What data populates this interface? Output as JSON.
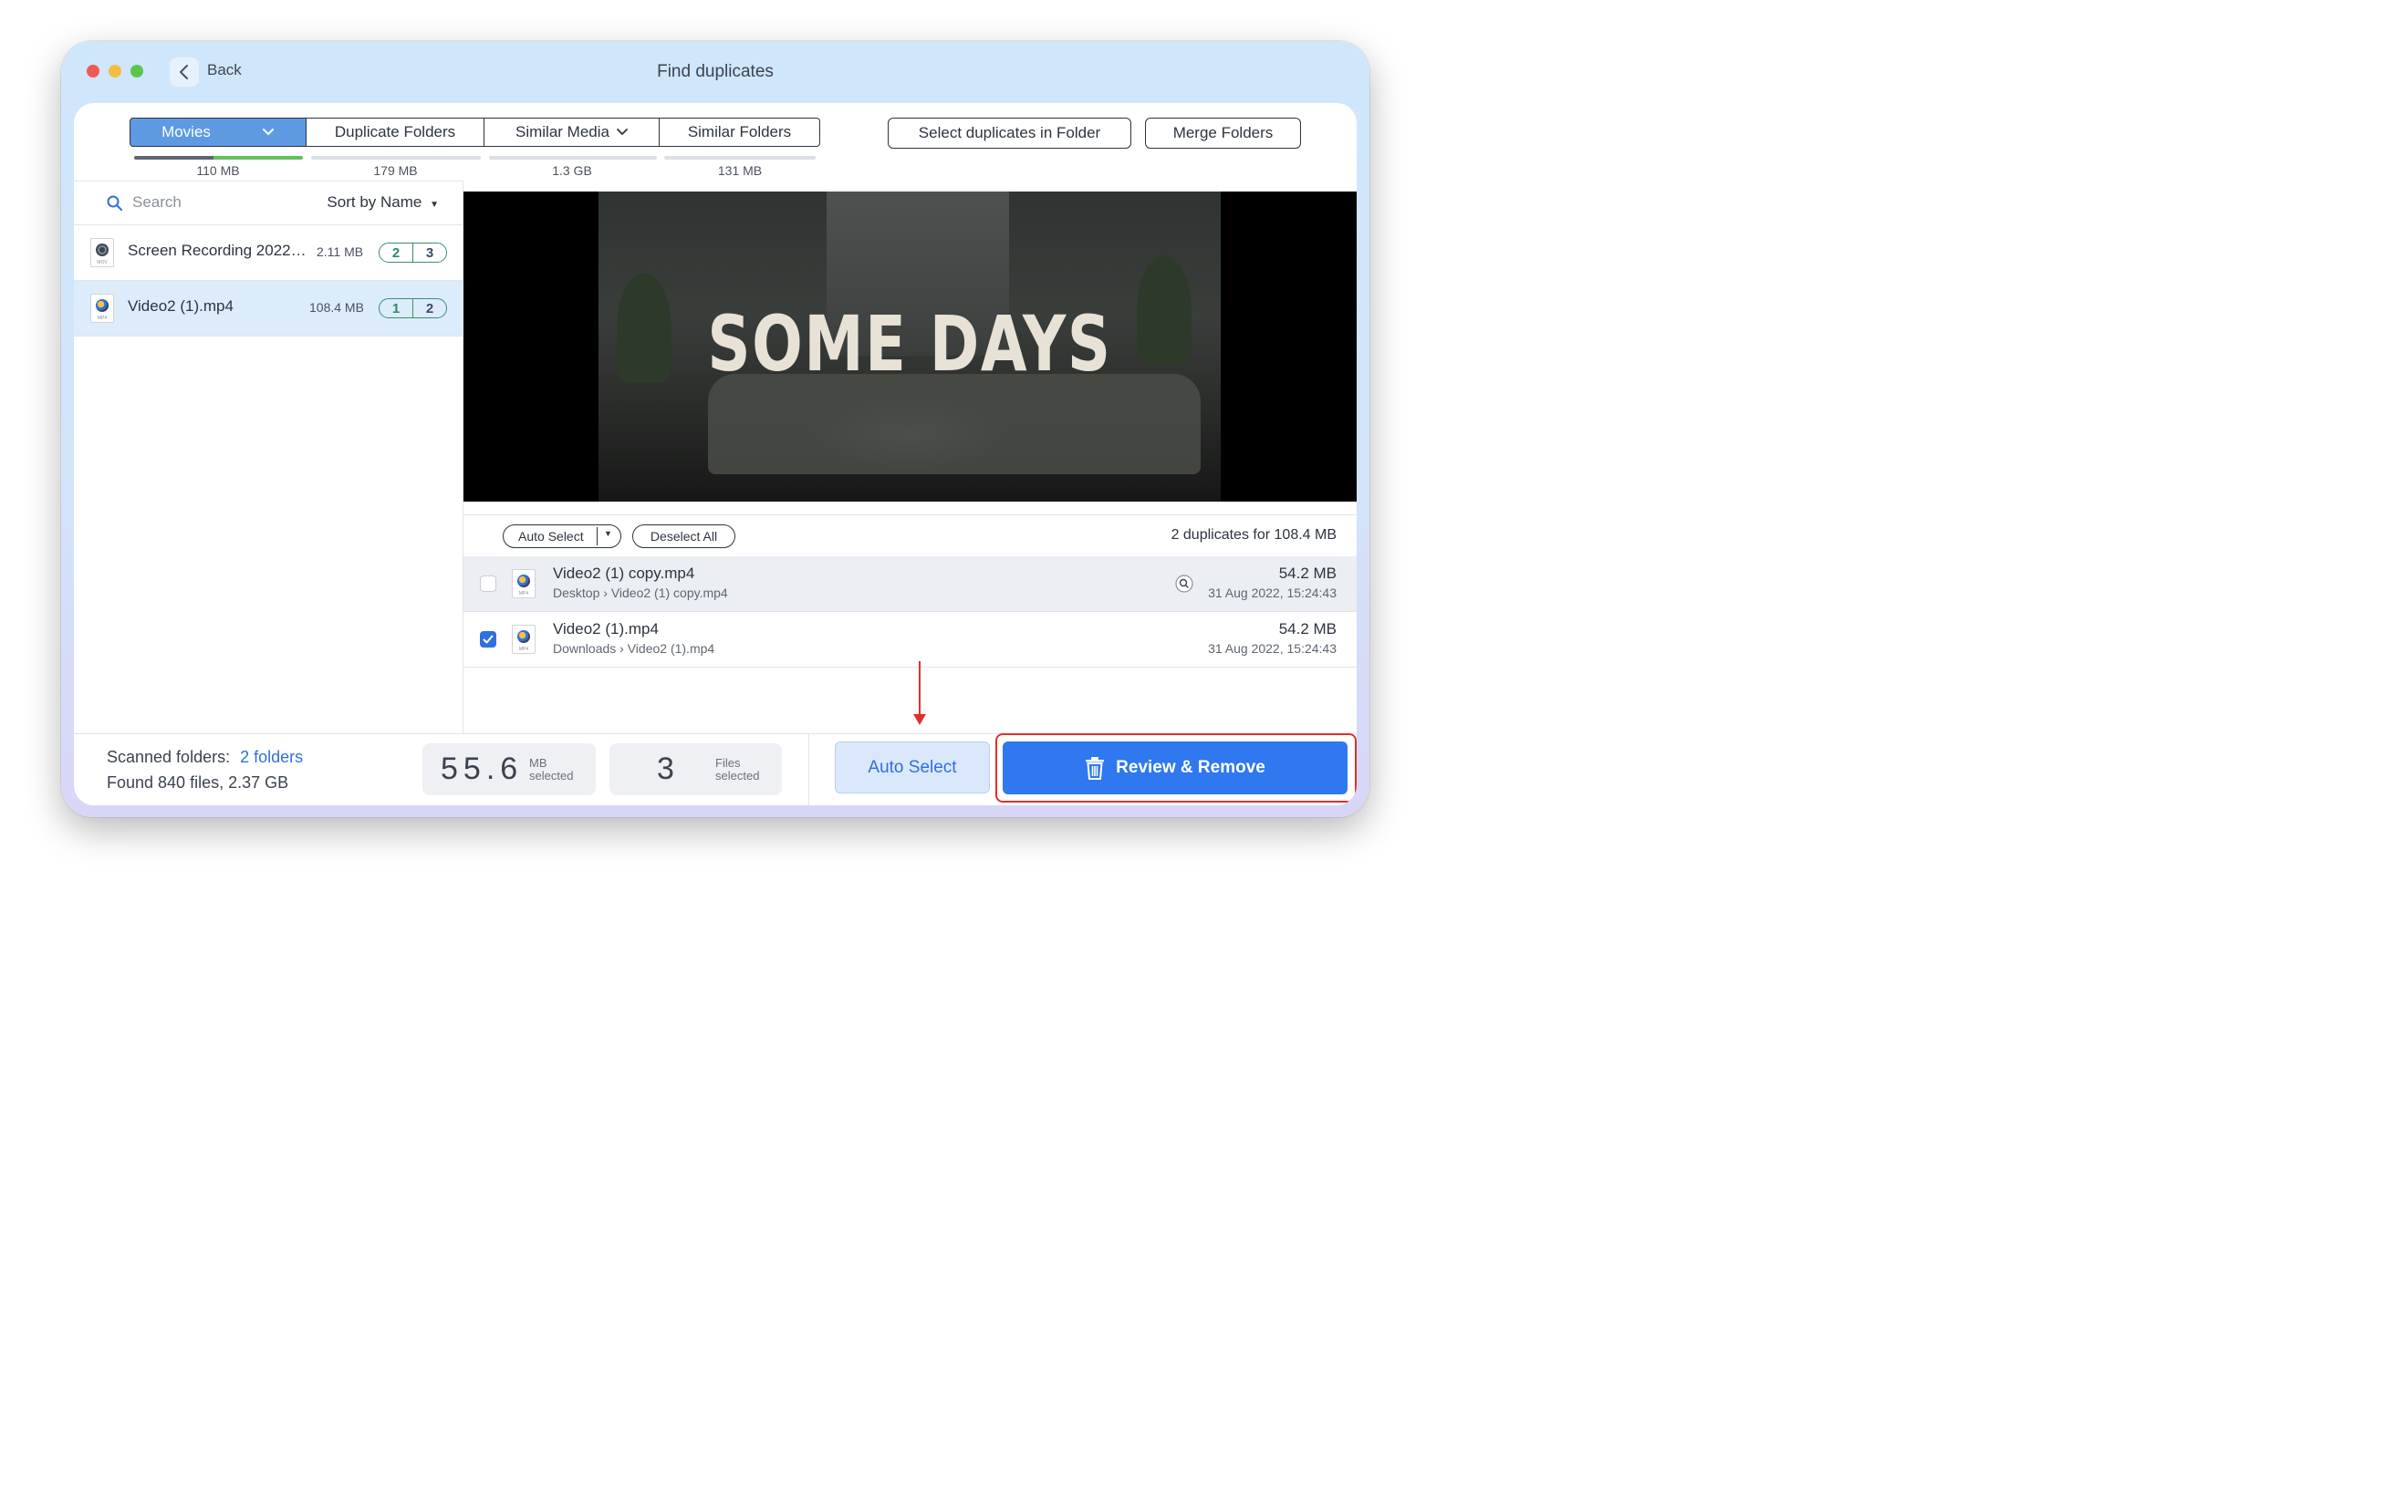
{
  "window": {
    "title": "Find duplicates",
    "back_label": "Back"
  },
  "tabs": [
    {
      "label": "Movies",
      "size": "110 MB",
      "has_dropdown": true,
      "selected": true
    },
    {
      "label": "Duplicate Folders",
      "size": "179 MB"
    },
    {
      "label": "Similar Media",
      "size": "1.3 GB",
      "has_dropdown": true
    },
    {
      "label": "Similar Folders",
      "size": "131 MB"
    }
  ],
  "header_buttons": {
    "select_in_folder": "Select duplicates in Folder",
    "merge_folders": "Merge Folders"
  },
  "sidebar": {
    "search_placeholder": "Search",
    "sort_label": "Sort by Name",
    "items": [
      {
        "name": "Screen Recording 2022…",
        "size": "2.11 MB",
        "count_a": "2",
        "count_b": "3",
        "ext": "MOV"
      },
      {
        "name": "Video2 (1).mp4",
        "size": "108.4 MB",
        "count_a": "1",
        "count_b": "2",
        "ext": "MP4",
        "selected": true
      }
    ]
  },
  "preview": {
    "overlay_text": "SOME DAYS"
  },
  "duplicates": {
    "auto_select_label": "Auto Select",
    "deselect_all_label": "Deselect All",
    "summary": "2 duplicates for 108.4 MB",
    "rows": [
      {
        "name": "Video2 (1) copy.mp4",
        "folder": "Desktop",
        "file": "Video2 (1) copy.mp4",
        "size": "54.2 MB",
        "date": "31 Aug 2022, 15:24:43",
        "checked": false
      },
      {
        "name": "Video2 (1).mp4",
        "folder": "Downloads",
        "file": "Video2 (1).mp4",
        "size": "54.2 MB",
        "date": "31 Aug 2022, 15:24:43",
        "checked": true
      }
    ]
  },
  "footer": {
    "scanned_label": "Scanned folders:",
    "scanned_link": "2 folders",
    "found_text": "Found 840 files, 2.37 GB",
    "selected_size_value": "55.6",
    "selected_size_unit": "MB",
    "selected_size_caption": "selected",
    "files_value": "3",
    "files_unit": "Files",
    "files_caption": "selected",
    "auto_select_label": "Auto Select",
    "review_remove_label": "Review & Remove"
  },
  "colors": {
    "accent": "#2f78f0",
    "tab_selected": "#5d9ae2",
    "highlight": "#e0302a",
    "count_green": "#2e8a63"
  }
}
